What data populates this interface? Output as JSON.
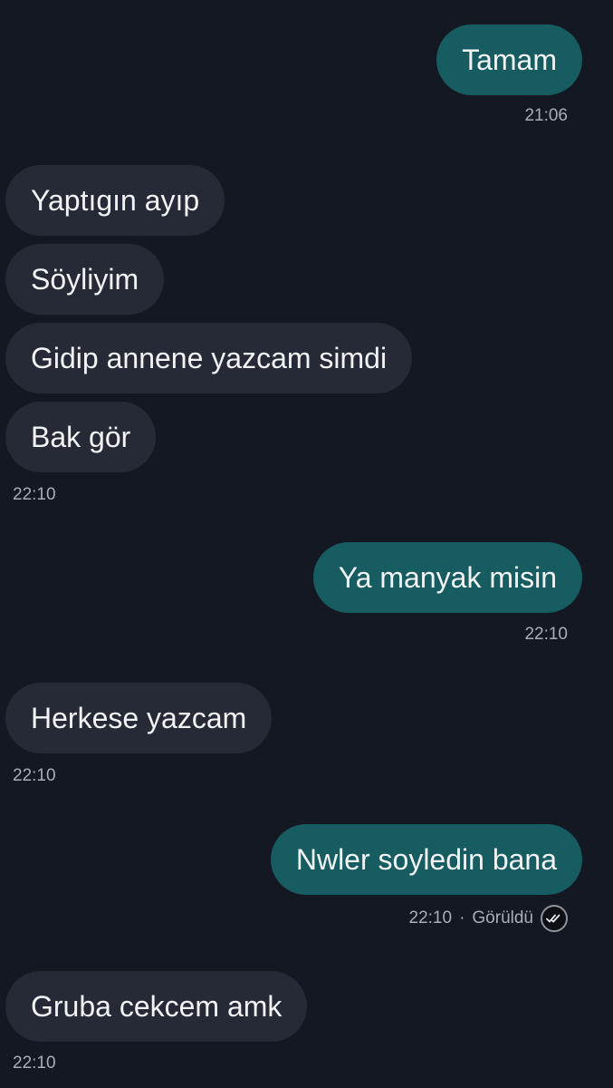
{
  "messages": [
    {
      "text": "Tamam"
    },
    {
      "text": "Yaptıgın ayıp"
    },
    {
      "text": "Söyliyim"
    },
    {
      "text": "Gidip annene yazcam simdi"
    },
    {
      "text": "Bak gör"
    },
    {
      "text": "Ya manyak misin"
    },
    {
      "text": "Herkese yazcam"
    },
    {
      "text": "Nwler soyledin bana"
    },
    {
      "text": "Gruba cekcem amk"
    }
  ],
  "timestamps": [
    "21:06",
    "22:10",
    "22:10",
    "22:10",
    "22:10",
    "22:10"
  ],
  "status": {
    "time": "22:10",
    "separator": "·",
    "label": "Görüldü",
    "icon": "double-check-icon"
  },
  "colors": {
    "background": "#141822",
    "incoming_bubble": "#252a36",
    "outgoing_bubble": "#165c61",
    "text": "#f1f3f5",
    "meta_text": "#a8adb7"
  }
}
